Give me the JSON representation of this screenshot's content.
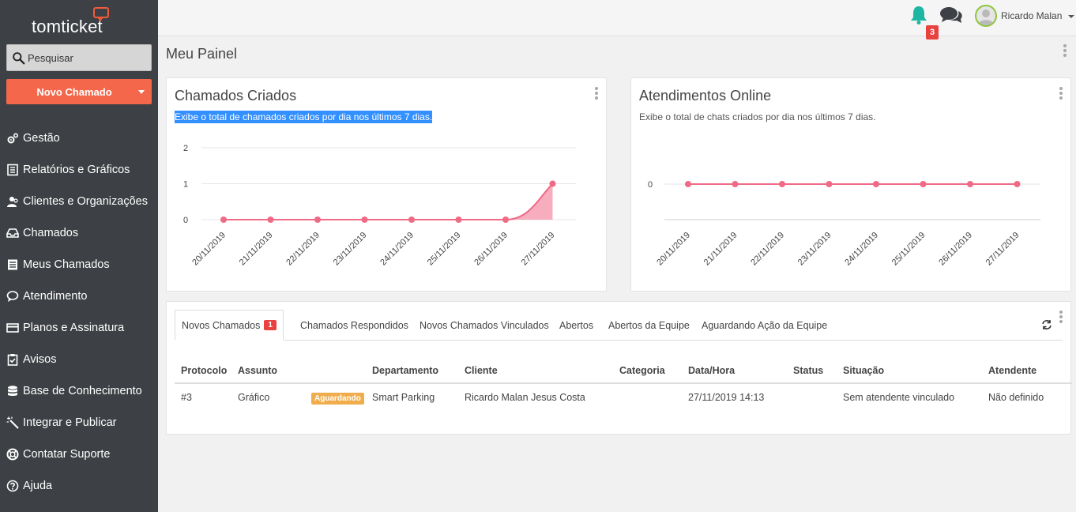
{
  "app": {
    "logo_text": "tomticket"
  },
  "sidebar": {
    "search_placeholder": "Pesquisar",
    "new_ticket_label": "Novo Chamado",
    "items": [
      {
        "label": "Gestão",
        "icon": "gears-icon"
      },
      {
        "label": "Relatórios e Gráficos",
        "icon": "report-icon"
      },
      {
        "label": "Clientes e Organizações",
        "icon": "users-icon"
      },
      {
        "label": "Chamados",
        "icon": "inbox-icon"
      },
      {
        "label": "Meus Chamados",
        "icon": "tickets-icon"
      },
      {
        "label": "Atendimento",
        "icon": "chat-bubble-icon"
      },
      {
        "label": "Planos e Assinatura",
        "icon": "credit-card-icon"
      },
      {
        "label": "Avisos",
        "icon": "clipboard-check-icon"
      },
      {
        "label": "Base de Conhecimento",
        "icon": "database-icon"
      },
      {
        "label": "Integrar e Publicar",
        "icon": "magic-wand-icon"
      },
      {
        "label": "Contatar Suporte",
        "icon": "lifebuoy-icon"
      },
      {
        "label": "Ajuda",
        "icon": "question-circle-icon"
      }
    ]
  },
  "topbar": {
    "notifications_count": "3",
    "user_name": "Ricardo Malan"
  },
  "page": {
    "title": "Meu Painel"
  },
  "widgets": {
    "created": {
      "title": "Chamados Criados",
      "subtitle": "Exibe o total de chamados criados por dia nos últimos 7 dias."
    },
    "online": {
      "title": "Atendimentos Online",
      "subtitle": "Exibe o total de chats criados por dia nos últimos 7 dias."
    }
  },
  "chart_data": [
    {
      "type": "area",
      "title": "Chamados Criados",
      "categories": [
        "20/11/2019",
        "21/11/2019",
        "22/11/2019",
        "23/11/2019",
        "24/11/2019",
        "25/11/2019",
        "26/11/2019",
        "27/11/2019"
      ],
      "series": [
        {
          "values": [
            0,
            0,
            0,
            0,
            0,
            0,
            0,
            1
          ]
        }
      ],
      "yticks": [
        0,
        1,
        2
      ],
      "ylim": [
        0,
        2
      ],
      "color": "#f06a86",
      "grid": true
    },
    {
      "type": "line",
      "title": "Atendimentos Online",
      "categories": [
        "20/11/2019",
        "21/11/2019",
        "22/11/2019",
        "23/11/2019",
        "24/11/2019",
        "25/11/2019",
        "26/11/2019",
        "27/11/2019"
      ],
      "series": [
        {
          "values": [
            0,
            0,
            0,
            0,
            0,
            0,
            0,
            0
          ]
        }
      ],
      "yticks": [
        0
      ],
      "color": "#f06a86",
      "grid": true
    }
  ],
  "tickets": {
    "tabs": [
      {
        "label": "Novos Chamados",
        "badge": "1"
      },
      {
        "label": "Chamados Respondidos"
      },
      {
        "label": "Novos Chamados Vinculados"
      },
      {
        "label": "Abertos"
      },
      {
        "label": "Abertos da Equipe"
      },
      {
        "label": "Aguardando Ação da Equipe"
      }
    ],
    "columns": [
      "Protocolo",
      "Assunto",
      "",
      "Departamento",
      "Cliente",
      "Categoria",
      "Data/Hora",
      "Status",
      "Situação",
      "Atendente"
    ],
    "rows": [
      {
        "protocolo": "#3",
        "assunto": "Gráfico",
        "status_badge": "Aguardando",
        "departamento": "Smart Parking",
        "cliente": "Ricardo Malan Jesus Costa",
        "categoria": "",
        "data_hora": "27/11/2019 14:13",
        "status": "",
        "situacao": "Sem atendente vinculado",
        "atendente": "Não definido"
      }
    ]
  }
}
